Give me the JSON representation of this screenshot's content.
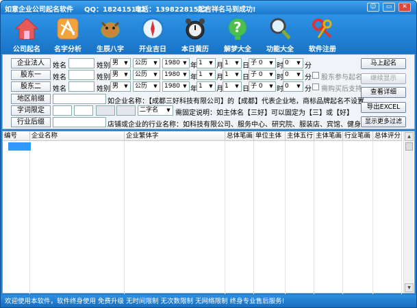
{
  "title": {
    "app": "如意企业公司起名软件",
    "qq": "QQ：182415132",
    "phone": "电话：13982281527",
    "slogan": "起吉祥名马到成功!"
  },
  "window_buttons": [
    "☺",
    "▭",
    "✕"
  ],
  "toolbar": [
    {
      "label": "公司起名",
      "icon": "house-icon",
      "color": "#e05050"
    },
    {
      "label": "名字分析",
      "icon": "analysis-icon",
      "color": "#f0a020"
    },
    {
      "label": "生辰八字",
      "icon": "horse-icon",
      "color": "#b0702c"
    },
    {
      "label": "开业吉日",
      "icon": "compass-icon",
      "color": "#3aa0ee"
    },
    {
      "label": "本日黄历",
      "icon": "alarm-clock-icon",
      "color": "#222"
    },
    {
      "label": "解梦大全",
      "icon": "question-icon",
      "color": "#39b24a"
    },
    {
      "label": "功能大全",
      "icon": "magnifier-icon",
      "color": "#445"
    },
    {
      "label": "软件注册",
      "icon": "keys-icon",
      "color": "#d23"
    }
  ],
  "persons": [
    {
      "role": "企业法人",
      "name_label": "姓名",
      "gender_label": "姓别",
      "gender": "男",
      "calendar": "公历",
      "year": "1980",
      "year_unit": "年",
      "month": "1",
      "month_unit": "月",
      "day": "1",
      "day_unit": "日",
      "zi": "子 0",
      "hour_unit": "时",
      "minute": "0",
      "minute_unit": "分",
      "check": ""
    },
    {
      "role": "股东一",
      "name_label": "姓名",
      "gender_label": "姓别",
      "gender": "男",
      "calendar": "公历",
      "year": "1980",
      "year_unit": "年",
      "month": "1",
      "month_unit": "月",
      "day": "1",
      "day_unit": "日",
      "zi": "子 0",
      "hour_unit": "时",
      "minute": "0",
      "minute_unit": "分",
      "check": "股东参与起名"
    },
    {
      "role": "股东二",
      "name_label": "姓名",
      "gender_label": "姓别",
      "gender": "男",
      "calendar": "公历",
      "year": "1980",
      "year_unit": "年",
      "month": "1",
      "month_unit": "月",
      "day": "1",
      "day_unit": "日",
      "zi": "子 0",
      "hour_unit": "时",
      "minute": "0",
      "minute_unit": "分",
      "check": "需购买后支持"
    }
  ],
  "prefix": {
    "label": "地区前缀",
    "note": "如企业名称：【成都三好科技有限公司】的【成都】代表企业地，商标品牌起名不设置"
  },
  "fixed": {
    "label": "字词限定",
    "chars": "二字名",
    "note": "需固定说明：如主体名【三好】可以固定为【三】或【好】"
  },
  "suffix": {
    "label": "行业后缀",
    "note": "店铺或企业的行业名称：如科技有限公司、服务中心、研究院、服装店、宾馆、健身房等"
  },
  "buttons": {
    "start": "马上起名",
    "continue": "继续显示",
    "detail": "查看详细",
    "export": "导出EXCEL",
    "filter": "显示更多过滤"
  },
  "table": {
    "headers": [
      "编号",
      "企业名称",
      "企业繁体字",
      "总体笔画",
      "单位主体",
      "主体五行",
      "主体笔画",
      "行业笔画",
      "总体评分"
    ]
  },
  "status": "欢迎使用本软件，软件终身使用 免费升级 无时间限制 无次数限制 无网络限制 终身专业售后服务!"
}
